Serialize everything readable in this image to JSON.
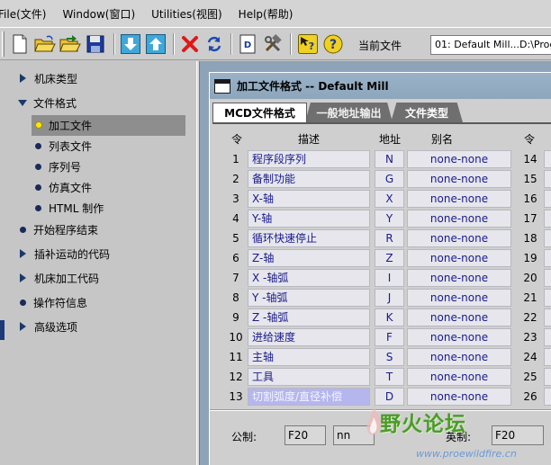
{
  "menu": [
    {
      "label": "File(文件)",
      "name": "menu-file"
    },
    {
      "label": "Window(窗口)",
      "name": "menu-window"
    },
    {
      "label": "Utilities(视图)",
      "name": "menu-utilities"
    },
    {
      "label": "Help(帮助)",
      "name": "menu-help"
    }
  ],
  "toolbar": {
    "current_file_label": "当前文件",
    "current_file_value": "01:  Default Mill...D:\\Prog"
  },
  "tree": {
    "items": [
      {
        "label": "机床类型"
      },
      {
        "label": "文件格式"
      },
      {
        "label": "加工文件"
      },
      {
        "label": "列表文件"
      },
      {
        "label": "序列号"
      },
      {
        "label": "仿真文件"
      },
      {
        "label": "HTML 制作"
      },
      {
        "label": "开始程序结束"
      },
      {
        "label": "插补运动的代码"
      },
      {
        "label": "机床加工代码"
      },
      {
        "label": "操作符信息"
      },
      {
        "label": "高级选项"
      }
    ]
  },
  "window": {
    "title": "加工文件格式 -- Default Mill",
    "tabs": [
      {
        "label": "MCD文件格式"
      },
      {
        "label": "一般地址输出"
      },
      {
        "label": "文件类型"
      }
    ]
  },
  "table": {
    "headers": {
      "num": "令",
      "desc": "描述",
      "addr": "地址",
      "alias": "别名",
      "num2": "令"
    },
    "rows": [
      {
        "num": "1",
        "desc": "程序段序列",
        "addr": "N",
        "alias": "none-none",
        "num2": "14"
      },
      {
        "num": "2",
        "desc": "备制功能",
        "addr": "G",
        "alias": "none-none",
        "num2": "15"
      },
      {
        "num": "3",
        "desc": "X-轴",
        "addr": "X",
        "alias": "none-none",
        "num2": "16"
      },
      {
        "num": "4",
        "desc": "Y-轴",
        "addr": "Y",
        "alias": "none-none",
        "num2": "17"
      },
      {
        "num": "5",
        "desc": "循环快速停止",
        "addr": "R",
        "alias": "none-none",
        "num2": "18"
      },
      {
        "num": "6",
        "desc": "Z-轴",
        "addr": "Z",
        "alias": "none-none",
        "num2": "19"
      },
      {
        "num": "7",
        "desc": "X -轴弧",
        "addr": "I",
        "alias": "none-none",
        "num2": "20"
      },
      {
        "num": "8",
        "desc": "Y -轴弧",
        "addr": "J",
        "alias": "none-none",
        "num2": "21"
      },
      {
        "num": "9",
        "desc": "Z -轴弧",
        "addr": "K",
        "alias": "none-none",
        "num2": "22"
      },
      {
        "num": "10",
        "desc": "进给速度",
        "addr": "F",
        "alias": "none-none",
        "num2": "23"
      },
      {
        "num": "11",
        "desc": "主轴",
        "addr": "S",
        "alias": "none-none",
        "num2": "24"
      },
      {
        "num": "12",
        "desc": "工具",
        "addr": "T",
        "alias": "none-none",
        "num2": "25"
      },
      {
        "num": "13",
        "desc": "切割弧度/直径补偿",
        "addr": "D",
        "alias": "none-none",
        "num2": "26"
      }
    ]
  },
  "footer": {
    "metric_label": "公制:",
    "metric_format": "F20",
    "metric_unit": "nn",
    "imperial_label": "英制:",
    "imperial_format": "F20"
  },
  "watermark": {
    "logo_text": "野火论坛",
    "url": "www.proewildfire.cn"
  },
  "colors": {
    "selection": "#8e8e8e",
    "content_bg": "#8da3b7",
    "cell_text": "#1a1a8c",
    "highlight_cell": "#b6b6ee"
  }
}
